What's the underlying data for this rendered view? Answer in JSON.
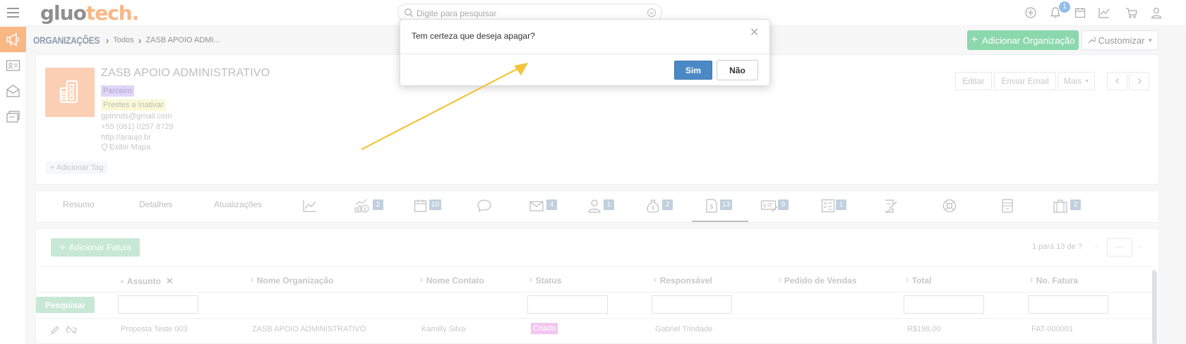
{
  "topbar": {
    "logo_part1": "gluo",
    "logo_part2": "tech.",
    "search_placeholder": "Digite para pesquisar",
    "notification_count": "1",
    "icons": [
      "plus-circle-icon",
      "bell-icon",
      "calendar-icon",
      "chart-line-icon",
      "cart-icon",
      "user-icon"
    ]
  },
  "sidebar": {
    "icons": [
      "megaphone-icon",
      "contact-card-icon",
      "inbox-icon",
      "folder-icon"
    ],
    "active_index": 0
  },
  "breadcrumb": {
    "module": "ORGANIZAÇÕES",
    "items": [
      "Todos",
      "ZASB APOIO ADMI..."
    ]
  },
  "header_actions": {
    "add_label": "Adicionar Organização",
    "customize_label": "Customizar"
  },
  "record": {
    "name": "ZASB APOIO ADMINISTRATIVO",
    "tags": [
      "Parceiro",
      "Prestes a Inativar"
    ],
    "email": "gptrinds@gmail.com",
    "phone": "+55 (061) 0257 8729",
    "website": "http://araujo.br",
    "map_label": "Exibir Mapa",
    "add_tag_label": "Adicionar Tag",
    "actions": {
      "edit": "Editar",
      "send_email": "Enviar Email",
      "more": "Mais"
    }
  },
  "tabs": {
    "text_tabs": [
      "Resumo",
      "Detalhes",
      "Atualizações"
    ],
    "icon_tabs": [
      {
        "icon": "chart-icon",
        "badge": ""
      },
      {
        "icon": "revenue-icon",
        "badge": "2"
      },
      {
        "icon": "calendar-icon",
        "badge": "10"
      },
      {
        "icon": "chat-icon",
        "badge": ""
      },
      {
        "icon": "mail-icon",
        "badge": "4"
      },
      {
        "icon": "person-icon",
        "badge": "1"
      },
      {
        "icon": "money-bag-icon",
        "badge": "2"
      },
      {
        "icon": "invoice-icon",
        "badge": "13"
      },
      {
        "icon": "quote-icon",
        "badge": "9"
      },
      {
        "icon": "checklist-icon",
        "badge": "1"
      },
      {
        "icon": "contract-icon",
        "badge": ""
      },
      {
        "icon": "support-icon",
        "badge": ""
      },
      {
        "icon": "document-icon",
        "badge": ""
      },
      {
        "icon": "briefcase-icon",
        "badge": "2"
      }
    ],
    "active": "invoice-icon"
  },
  "list": {
    "add_label": "Adicionar Fatura",
    "pager_text": "1 para 13  de ?",
    "more_label": "···",
    "columns": [
      "Assunto",
      "Nome Organização",
      "Nome Contato",
      "Status",
      "Responsável",
      "Pedido de Vendas",
      "Total",
      "No. Fatura"
    ],
    "search_button": "Pesquisar",
    "rows": [
      {
        "assunto": "Proposta Teste 003",
        "organizacao": "ZASB APOIO ADMINISTRATIVO",
        "contato": "Kamilly Silva",
        "status": "Criado",
        "responsavel": "Gabriel Trindade",
        "pedido": "",
        "total": "R$198,00",
        "fatura": "FAT-000001"
      }
    ]
  },
  "modal": {
    "title": "Tem certeza que deseja apagar?",
    "yes_label": "Sim",
    "no_label": "Não"
  },
  "colors": {
    "brand_orange": "#f47c20",
    "green": "#2db86b",
    "primary_blue": "#4a89c6",
    "arrow_yellow": "#f2c53d"
  }
}
